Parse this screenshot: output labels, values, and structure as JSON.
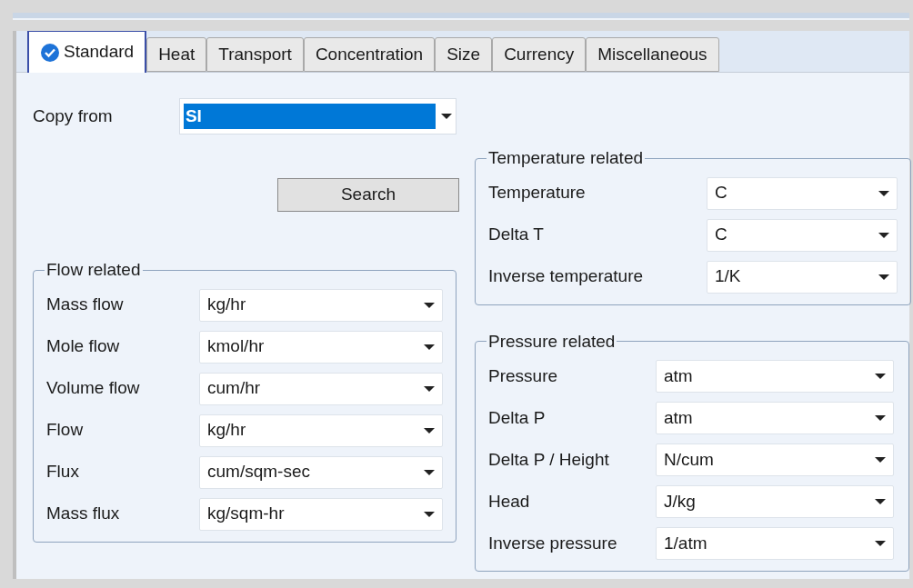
{
  "tabs": [
    {
      "label": "Standard",
      "selected": true,
      "checked": true
    },
    {
      "label": "Heat",
      "selected": false,
      "checked": false
    },
    {
      "label": "Transport",
      "selected": false,
      "checked": false
    },
    {
      "label": "Concentration",
      "selected": false,
      "checked": false
    },
    {
      "label": "Size",
      "selected": false,
      "checked": false
    },
    {
      "label": "Currency",
      "selected": false,
      "checked": false
    },
    {
      "label": "Miscellaneous",
      "selected": false,
      "checked": false
    }
  ],
  "copy_from": {
    "label": "Copy from",
    "value": "SI",
    "highlighted": true
  },
  "search_button": "Search",
  "flow_related": {
    "title": "Flow related",
    "rows": [
      {
        "label": "Mass flow",
        "value": "kg/hr"
      },
      {
        "label": "Mole flow",
        "value": "kmol/hr"
      },
      {
        "label": "Volume flow",
        "value": "cum/hr"
      },
      {
        "label": "Flow",
        "value": "kg/hr"
      },
      {
        "label": "Flux",
        "value": "cum/sqm-sec"
      },
      {
        "label": "Mass flux",
        "value": "kg/sqm-hr"
      }
    ]
  },
  "temperature_related": {
    "title": "Temperature related",
    "rows": [
      {
        "label": "Temperature",
        "value": "C"
      },
      {
        "label": "Delta T",
        "value": "C"
      },
      {
        "label": "Inverse temperature",
        "value": "1/K"
      }
    ]
  },
  "pressure_related": {
    "title": "Pressure related",
    "rows": [
      {
        "label": "Pressure",
        "value": "atm"
      },
      {
        "label": "Delta P",
        "value": "atm"
      },
      {
        "label": "Delta P / Height",
        "value": "N/cum"
      },
      {
        "label": "Head",
        "value": "J/kg"
      },
      {
        "label": "Inverse pressure",
        "value": "1/atm"
      }
    ]
  }
}
